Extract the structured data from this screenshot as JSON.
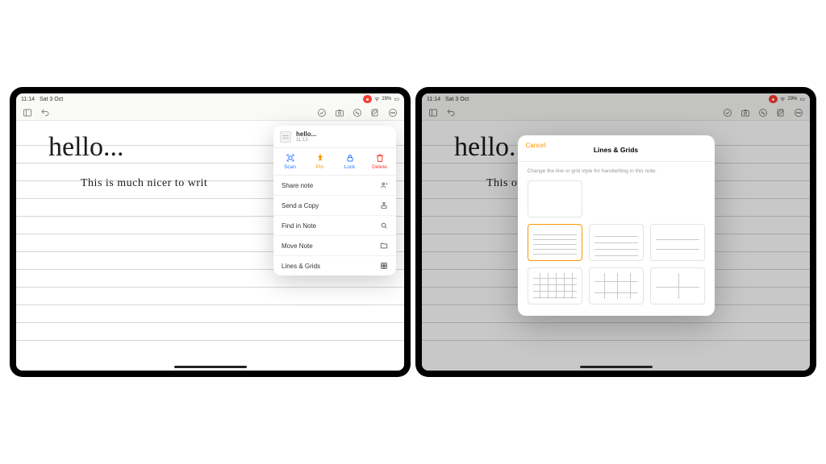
{
  "status": {
    "time": "11:14",
    "date": "Sat 3 Oct",
    "battery": "29%"
  },
  "note": {
    "title_hand": "hello...",
    "line1_left": "This  is  much  nicer  to  writ",
    "line1_right": "This                                                                 on!"
  },
  "popover1": {
    "header_title": "hello...",
    "header_sub": "11:13",
    "quick": {
      "scan": "Scan",
      "pin": "Pin",
      "lock": "Lock",
      "delete": "Delete"
    },
    "items": {
      "share": "Share note",
      "sendcopy": "Send a Copy",
      "find": "Find in Note",
      "move": "Move Note",
      "lines": "Lines & Grids"
    }
  },
  "popover2": {
    "cancel": "Cancel",
    "title": "Lines & Grids",
    "desc": "Change the line or grid style for handwriting in this note."
  }
}
